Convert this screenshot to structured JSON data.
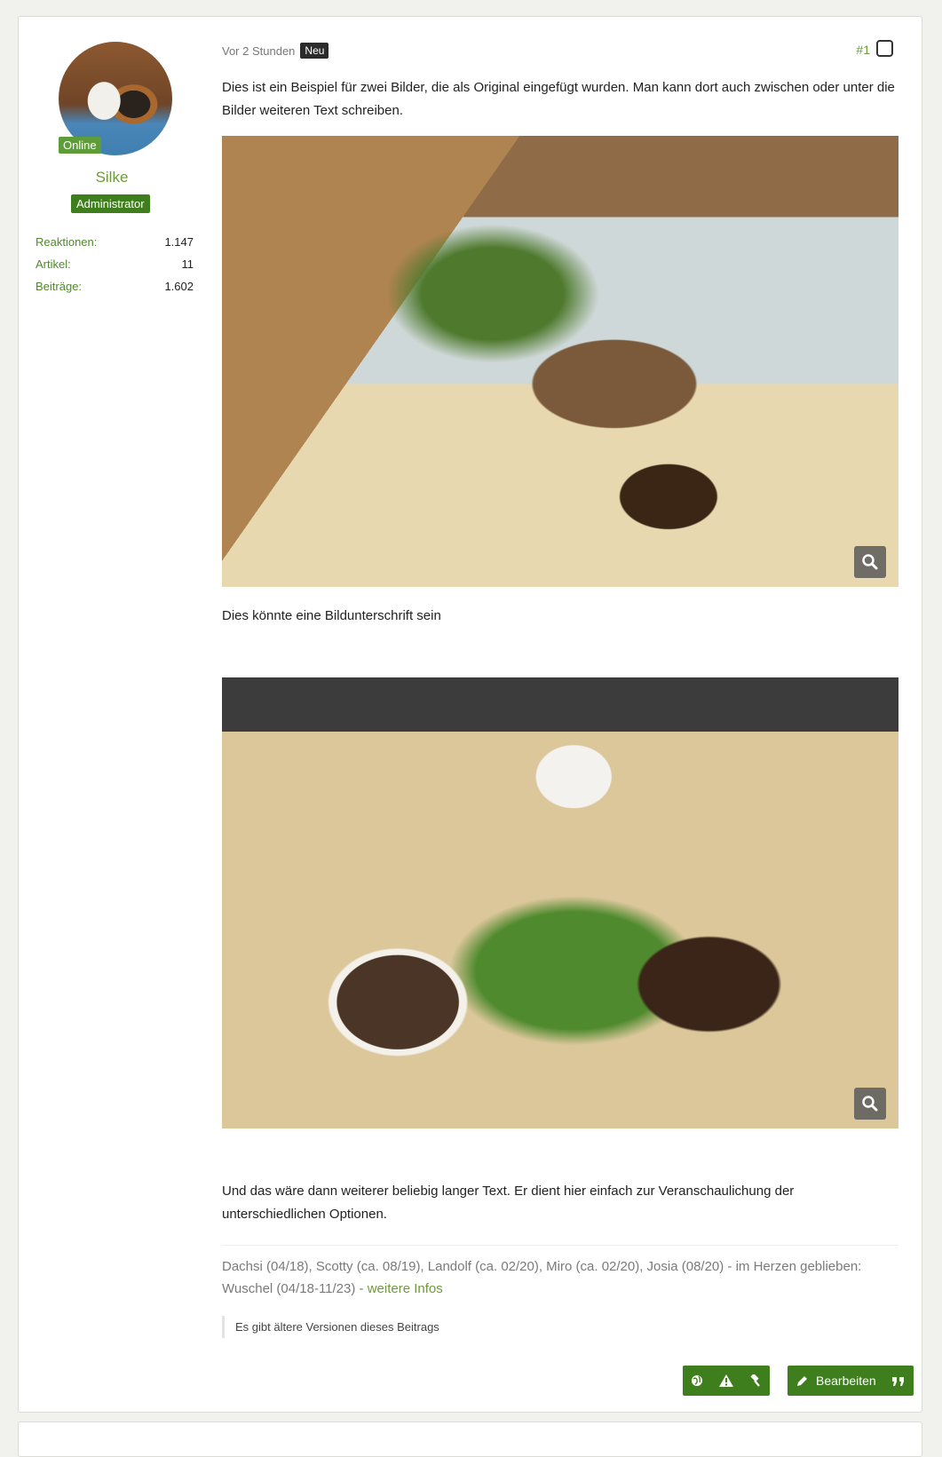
{
  "author": {
    "status": "Online",
    "name": "Silke",
    "role": "Administrator",
    "stats": [
      {
        "label": "Reaktionen:",
        "value": "1.147"
      },
      {
        "label": "Artikel:",
        "value": "11"
      },
      {
        "label": "Beiträge:",
        "value": "1.602"
      }
    ]
  },
  "post": {
    "time": "Vor 2 Stunden",
    "new_badge": "Neu",
    "number": "#1",
    "intro": "Dies ist ein Beispiel für zwei Bilder, die als Original eingefügt wurden. Man kann dort auch zwischen oder unter die Bilder weiteren Text schreiben.",
    "caption": "Dies könnte eine Bildunterschrift sein",
    "outro": "Und das wäre dann weiterer beliebig langer Text. Er dient hier einfach zur Veranschaulichung der unterschiedlichen Optionen.",
    "signature_text": "Dachsi (04/18), Scotty (ca. 08/19), Landolf (ca. 02/20), Miro (ca. 02/20), Josia (08/20) - im Herzen geblieben: Wuschel (04/18-11/23) - ",
    "signature_link": "weitere Infos",
    "versions_note": "Es gibt ältere Versionen dieses Beitrags"
  },
  "actions": {
    "edit_label": "Bearbeiten",
    "icons": [
      "globe-icon",
      "warning-icon",
      "hammer-icon",
      "pencil-icon",
      "quote-icon"
    ]
  },
  "colors": {
    "accent": "#3f7e1d",
    "link": "#6f9a3c",
    "online": "#5e9c3a"
  }
}
